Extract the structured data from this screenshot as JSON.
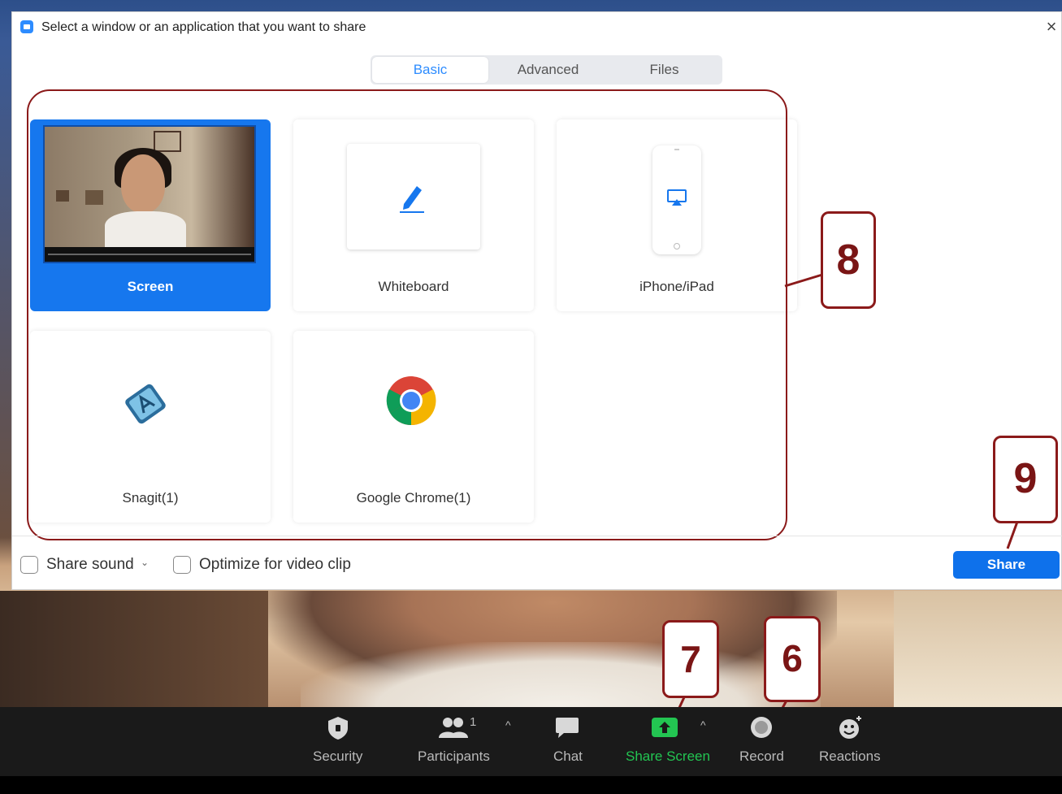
{
  "dialog": {
    "title": "Select a window or an application that you want to share",
    "close_symbol": "×",
    "tabs": [
      {
        "label": "Basic",
        "active": true
      },
      {
        "label": "Advanced",
        "active": false
      },
      {
        "label": "Files",
        "active": false
      }
    ],
    "options": [
      {
        "label": "Screen",
        "selected": true,
        "icon": "screen-preview"
      },
      {
        "label": "Whiteboard",
        "selected": false,
        "icon": "pencil-icon"
      },
      {
        "label": "iPhone/iPad",
        "selected": false,
        "icon": "airplay-icon"
      },
      {
        "label": "Snagit(1)",
        "selected": false,
        "icon": "snagit-icon"
      },
      {
        "label": "Google Chrome(1)",
        "selected": false,
        "icon": "chrome-icon"
      }
    ],
    "footer": {
      "share_sound_label": "Share sound",
      "share_sound_checked": false,
      "optimize_label": "Optimize for video clip",
      "optimize_checked": false,
      "share_button_label": "Share"
    }
  },
  "annotations": [
    "8",
    "9",
    "7",
    "6"
  ],
  "toolbar": {
    "items": [
      {
        "label": "Security",
        "icon": "shield-icon"
      },
      {
        "label": "Participants",
        "icon": "participants-icon",
        "count": "1"
      },
      {
        "label": "Chat",
        "icon": "chat-icon"
      },
      {
        "label": "Share Screen",
        "icon": "share-screen-icon",
        "active": true
      },
      {
        "label": "Record",
        "icon": "record-icon"
      },
      {
        "label": "Reactions",
        "icon": "reactions-icon"
      }
    ]
  },
  "colors": {
    "accent": "#0e71eb",
    "selected_card": "#1677ee",
    "share_screen_green": "#23c552",
    "annotation": "#8b1a1a",
    "toolbar_bg": "#1a1a1a"
  }
}
